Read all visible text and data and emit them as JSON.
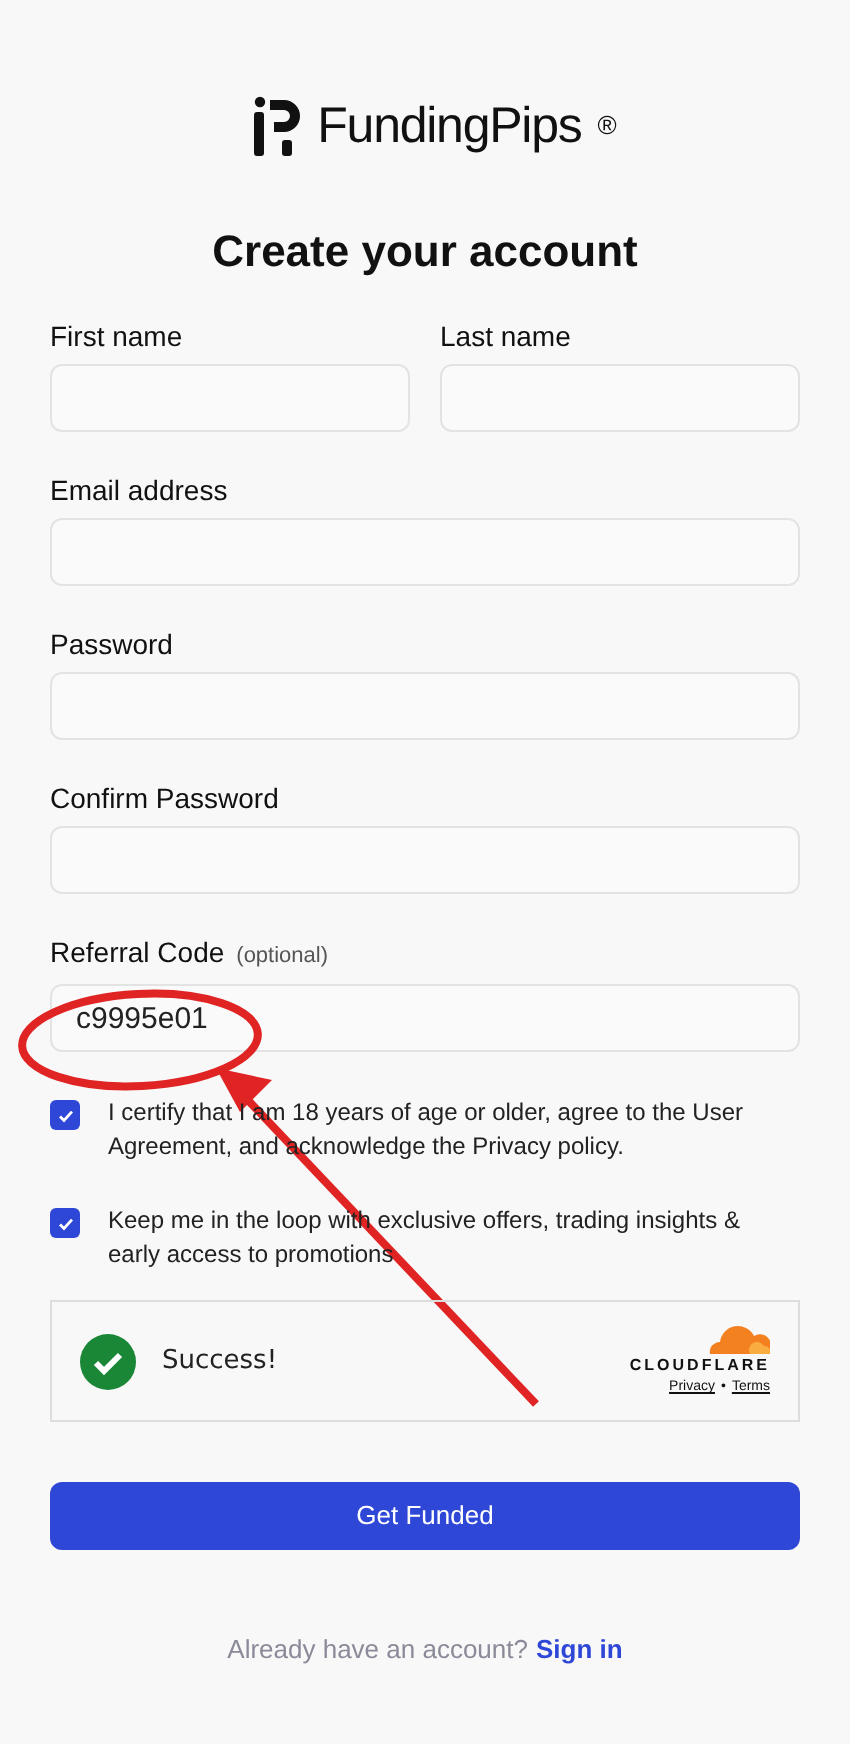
{
  "logo": {
    "text": "FundingPips",
    "mark": "®"
  },
  "title": "Create your account",
  "name_fields": [
    {
      "label": "First name"
    },
    {
      "label": "Last name"
    }
  ],
  "fields": [
    {
      "label": "Email address"
    },
    {
      "label": "Password"
    },
    {
      "label": "Confirm Password"
    },
    {
      "label": "Referral Code",
      "note": "(optional)",
      "value": "c9995e01"
    }
  ],
  "consents": [
    {
      "text": "I certify that I am 18 years of age or older, agree to the User Agreement, and acknowledge the Privacy policy.",
      "checked": true
    },
    {
      "text": "Keep me in the loop with exclusive offers, trading insights & early access to promotions",
      "checked": true
    }
  ],
  "captcha": {
    "status": "Success!",
    "brand": "CLOUDFLARE",
    "links": [
      "Privacy",
      "Terms"
    ],
    "separator": "•"
  },
  "submit": "Get Funded",
  "footer": {
    "text": "Already have an account?",
    "link": "Sign in"
  },
  "annotation": {
    "kind": "circle-arrow"
  }
}
